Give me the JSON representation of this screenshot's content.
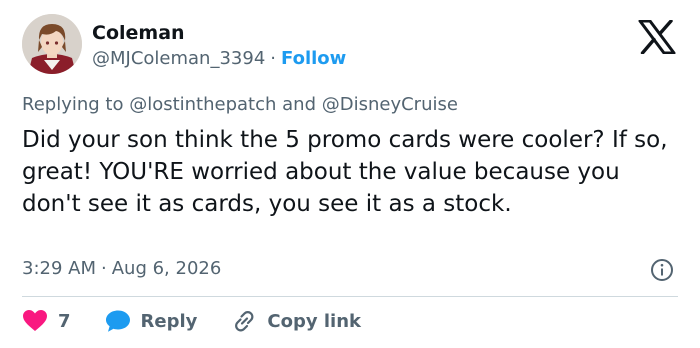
{
  "author": {
    "display_name": "Coleman",
    "handle": "@MJColeman_3394",
    "separator": "·",
    "follow_label": "Follow"
  },
  "reply_context": {
    "prefix": "Replying to ",
    "mention_1": "@lostinthepatch",
    "conjunction": " and ",
    "mention_2": "@DisneyCruise"
  },
  "tweet": {
    "text": "Did your son think the 5 promo cards were cooler? If so, great! YOU'RE worried about the value because you don't see it as cards, you see it as a stock."
  },
  "meta": {
    "time": "3:29 AM",
    "separator": "·",
    "date": "Aug 6, 2026"
  },
  "actions": {
    "like_count": "7",
    "reply_label": "Reply",
    "copy_link_label": "Copy link"
  },
  "icons": {
    "logo": "x-logo-icon",
    "info": "info-icon",
    "like": "heart-icon",
    "reply": "speech-bubble-icon",
    "copy": "link-icon"
  },
  "colors": {
    "text_primary": "#0f1419",
    "text_secondary": "#536471",
    "accent_blue": "#1d9bf0",
    "like_red": "#f91880",
    "divider": "#cfd9de"
  }
}
